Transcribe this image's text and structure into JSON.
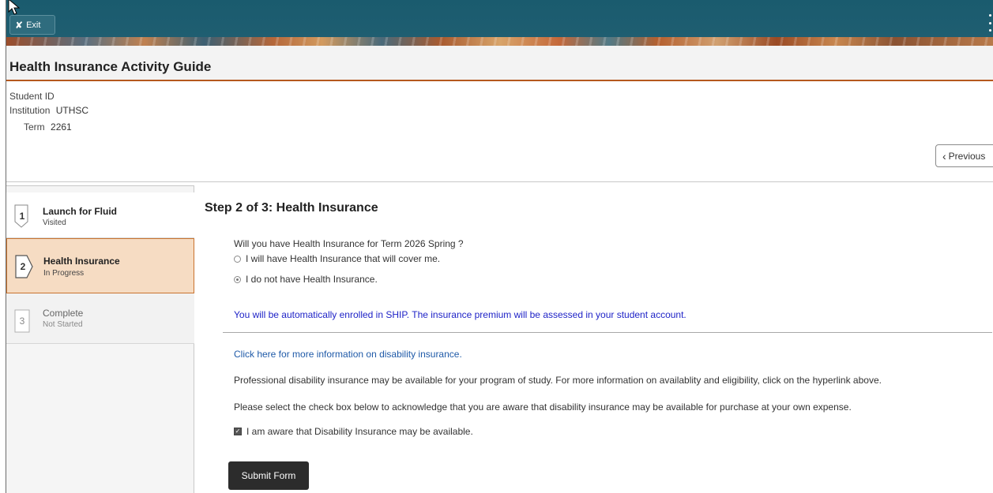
{
  "banner": {
    "exit_label": "Exit",
    "colors": {
      "bar": "#1d5c6d",
      "accent": "#b5581e"
    }
  },
  "page_title": "Health Insurance Activity Guide",
  "student_info": {
    "student_id_label": "Student ID",
    "student_id_value": "",
    "institution_label": "Institution",
    "institution_value": "UTHSC",
    "term_label": "Term",
    "term_value": "2261"
  },
  "nav": {
    "previous_label": "Previous"
  },
  "steps": [
    {
      "number": "1",
      "title": "Launch for Fluid",
      "status": "Visited",
      "state": "visited"
    },
    {
      "number": "2",
      "title": "Health Insurance",
      "status": "In Progress",
      "state": "current"
    },
    {
      "number": "3",
      "title": "Complete",
      "status": "Not Started",
      "state": "not-started"
    }
  ],
  "main": {
    "heading": "Step 2 of 3: Health Insurance",
    "question": "Will you have Health Insurance for Term 2026 Spring ?",
    "options": [
      {
        "label": "I will have Health Insurance that will cover me.",
        "selected": false
      },
      {
        "label": "I do not have Health Insurance.",
        "selected": true
      }
    ],
    "notice": "You will be automatically enrolled in SHIP. The insurance premium will be assessed in your student account.",
    "link_text": "Click here for more information on disability insurance.",
    "paragraph1": "Professional disability insurance may be available for your program of study. For more information on availablity and eligibility, click on the hyperlink above.",
    "paragraph2": "Please select the check box below to acknowledge that you are aware that disability insurance may be available for purchase at your own expense.",
    "checkbox_label": "I am aware that Disability Insurance may be available.",
    "checkbox_checked": true,
    "submit_label": "Submit Form"
  }
}
